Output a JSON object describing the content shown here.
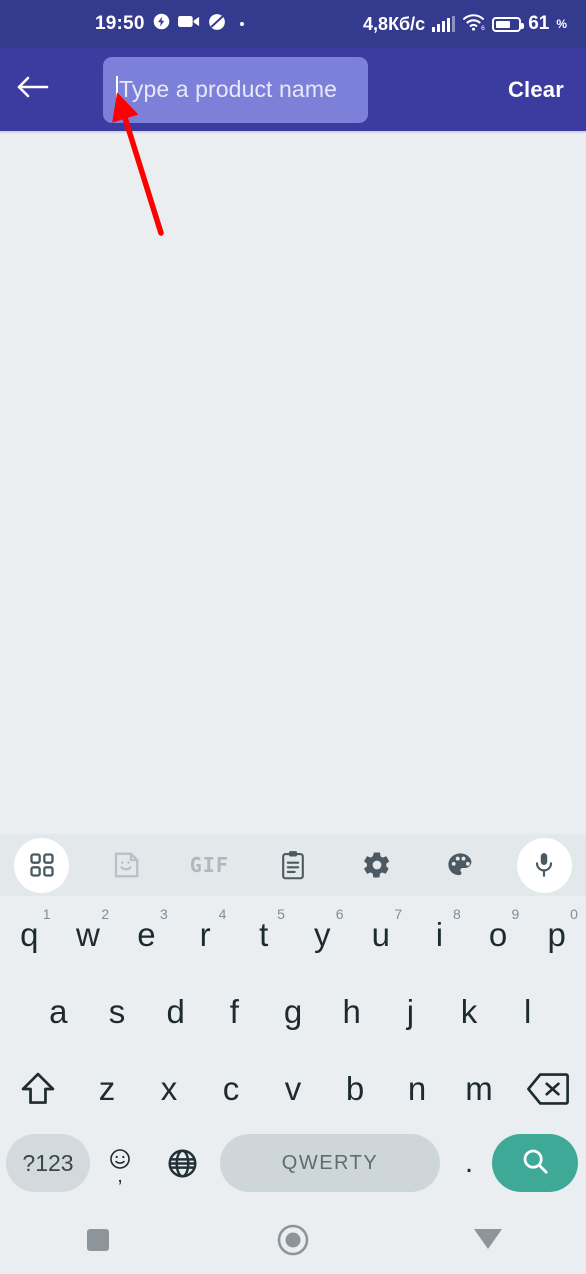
{
  "status_bar": {
    "time": "19:50",
    "icons_left": [
      "flash-icon",
      "video-camera-icon",
      "dnd-icon",
      "dot-icon"
    ],
    "network_speed": "4,8Кб/с",
    "signal": "signal-bars-icon",
    "wifi": "wifi-6-icon",
    "battery_level": "61",
    "battery_unit": "%",
    "bg_color": "#343a8e"
  },
  "app_bar": {
    "back_icon": "arrow-left-icon",
    "search": {
      "value": "",
      "placeholder": "Type a product name",
      "bg_color": "#7c80d8"
    },
    "clear_label": "Clear",
    "bg_color": "#3b3ba0"
  },
  "annotation": {
    "type": "arrow",
    "color": "#ff0000",
    "points_to": "search-input"
  },
  "content": {
    "bg_color": "#eaeef0",
    "body_text": ""
  },
  "keyboard": {
    "toolbar": [
      {
        "name": "apps-grid-icon",
        "label": "",
        "highlighted": true
      },
      {
        "name": "sticker-icon",
        "label": ""
      },
      {
        "name": "gif-icon",
        "label": "GIF"
      },
      {
        "name": "clipboard-icon",
        "label": ""
      },
      {
        "name": "gear-icon",
        "label": ""
      },
      {
        "name": "palette-icon",
        "label": ""
      },
      {
        "name": "microphone-icon",
        "label": "",
        "highlighted": true
      }
    ],
    "row1": [
      {
        "key": "q",
        "sup": "1"
      },
      {
        "key": "w",
        "sup": "2"
      },
      {
        "key": "e",
        "sup": "3"
      },
      {
        "key": "r",
        "sup": "4"
      },
      {
        "key": "t",
        "sup": "5"
      },
      {
        "key": "y",
        "sup": "6"
      },
      {
        "key": "u",
        "sup": "7"
      },
      {
        "key": "i",
        "sup": "8"
      },
      {
        "key": "o",
        "sup": "9"
      },
      {
        "key": "p",
        "sup": "0"
      }
    ],
    "row2": [
      "a",
      "s",
      "d",
      "f",
      "g",
      "h",
      "j",
      "k",
      "l"
    ],
    "row3": [
      "z",
      "x",
      "c",
      "v",
      "b",
      "n",
      "m"
    ],
    "shift_icon": "shift-icon",
    "backspace_icon": "backspace-icon",
    "row4": {
      "symbols_label": "?123",
      "emoji_icon": "emoji-icon",
      "comma_label": ",",
      "globe_icon": "globe-icon",
      "space_label": "QWERTY",
      "period_label": ".",
      "search_icon": "search-icon",
      "search_key_color": "#3fa997"
    }
  },
  "nav_bar": {
    "recents_icon": "square-recents-icon",
    "home_icon": "circle-home-icon",
    "back_icon": "triangle-down-back-icon"
  }
}
